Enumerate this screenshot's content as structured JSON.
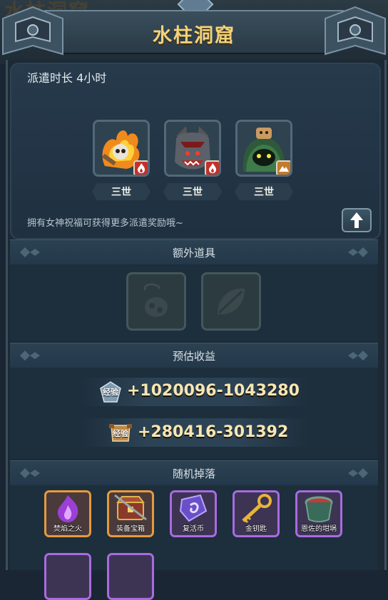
{
  "title": "水柱洞窟",
  "dispatch": {
    "label": "派遣时长",
    "value": "4小时"
  },
  "heroes": [
    {
      "label": "三世",
      "element": "fire-icon"
    },
    {
      "label": "三世",
      "element": "fire-icon"
    },
    {
      "label": "三世",
      "element": "earth-icon"
    }
  ],
  "hint": "拥有女神祝福可获得更多派遣奖励哦~",
  "sections": {
    "extra_items": "额外道具",
    "estimated_gain": "预估收益",
    "random_drops": "随机掉落"
  },
  "gains": [
    {
      "badge": "经验",
      "text": "+1020096-1043280"
    },
    {
      "badge": "经验",
      "text": "+280416-301392"
    }
  ],
  "drops": [
    {
      "label": "焚焰之火",
      "rarity": "orange"
    },
    {
      "label": "装备宝箱",
      "rarity": "orange"
    },
    {
      "label": "复活币",
      "rarity": "purple"
    },
    {
      "label": "金钥匙",
      "rarity": "purple"
    },
    {
      "label": "恩佐的坩埚",
      "rarity": "purple"
    }
  ],
  "colors": {
    "title": "#f2d27a",
    "orange_frame": "#e59a3e",
    "purple_frame": "#a86be0"
  }
}
